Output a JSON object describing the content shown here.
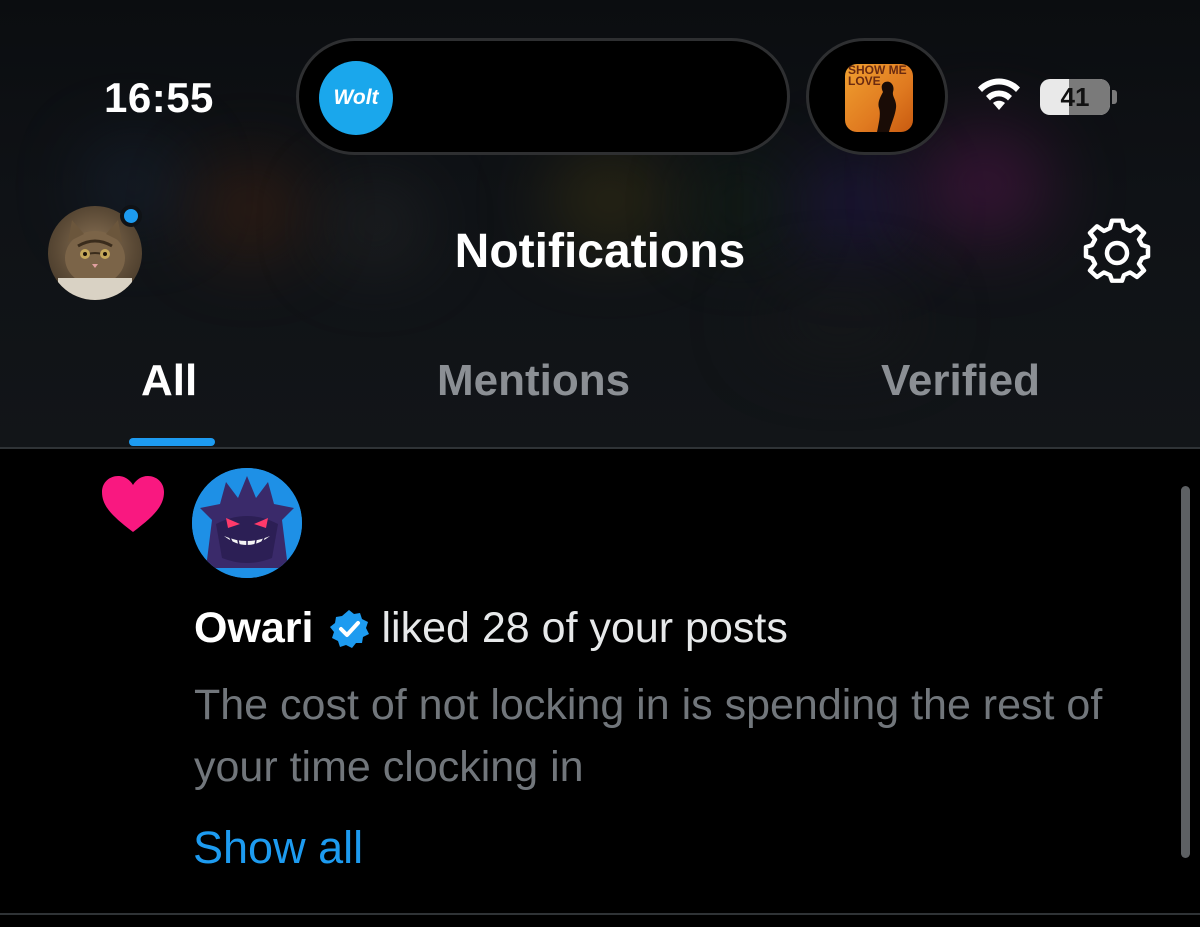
{
  "status_bar": {
    "time": "16:55",
    "live_activity_label": "Wolt",
    "album_art_text": "SHOW ME LOVE",
    "wifi_icon": "wifi-icon",
    "battery_level": "41",
    "battery_fraction": 0.41
  },
  "header": {
    "title": "Notifications",
    "settings_icon": "gear-icon",
    "avatar": "profile-avatar-cat"
  },
  "tabs": [
    {
      "label": "All",
      "active": true
    },
    {
      "label": "Mentions",
      "active": false
    },
    {
      "label": "Verified",
      "active": false
    }
  ],
  "notification": {
    "type_icon": "heart-icon",
    "type_color": "#f91880",
    "user": "Owari",
    "verified": true,
    "action": "liked 28 of your posts",
    "post_text": "The cost of not locking in is spending the rest of your time clocking in",
    "show_all": "Show all"
  },
  "colors": {
    "accent": "#1d9bf0",
    "like": "#f91880",
    "background": "#000000",
    "secondary_text": "#71767b"
  }
}
